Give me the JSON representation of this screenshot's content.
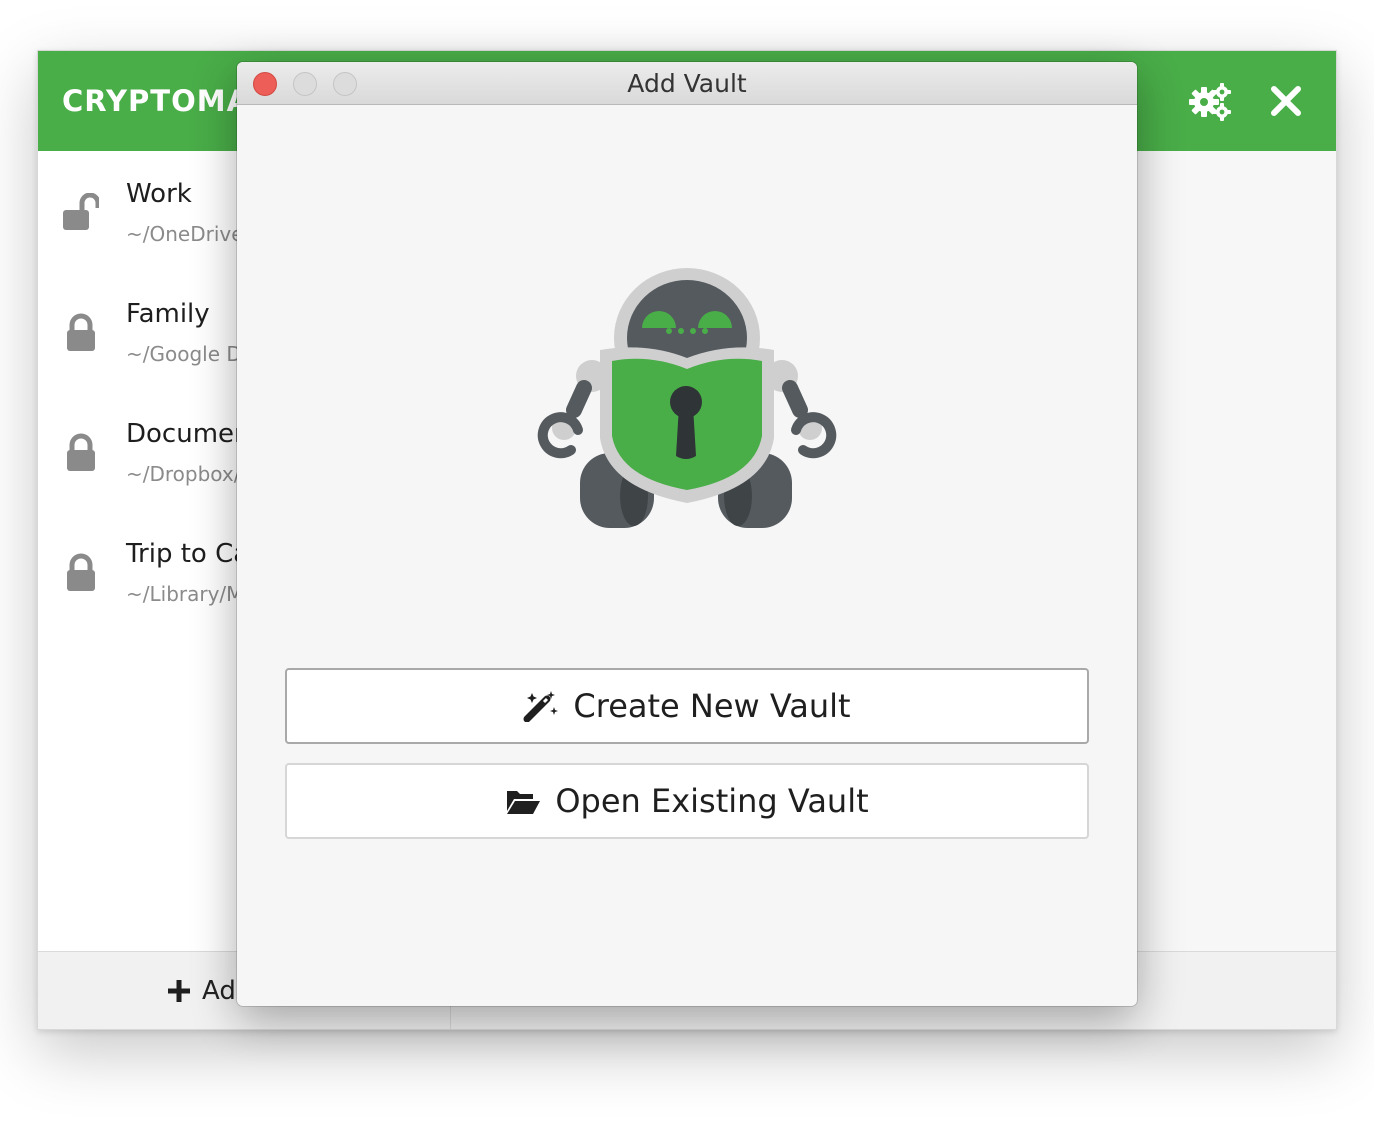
{
  "app": {
    "brand": "CRYPTOMAT",
    "accent_color": "#49ad48",
    "icons": {
      "settings": "gears-icon",
      "close": "close-x-icon"
    }
  },
  "vaults": [
    {
      "name": "Work",
      "path": "~/OneDrive",
      "locked": false,
      "icon": "unlocked-padlock-icon"
    },
    {
      "name": "Family",
      "path": "~/Google Dr",
      "locked": true,
      "icon": "padlock-icon"
    },
    {
      "name": "Documen",
      "path": "~/Dropbox/",
      "locked": true,
      "icon": "padlock-icon"
    },
    {
      "name": "Trip to Ca",
      "path": "~/Library/M",
      "locked": true,
      "icon": "padlock-icon"
    }
  ],
  "footer": {
    "add_label": "Add",
    "icon": "plus-icon"
  },
  "dialog": {
    "title": "Add Vault",
    "logo": "cryptomator-robot-logo",
    "create_label": "Create New Vault",
    "create_icon": "magic-wand-icon",
    "open_label": "Open Existing Vault",
    "open_icon": "folder-open-icon",
    "window_controls": [
      "close",
      "minimize",
      "zoom"
    ]
  }
}
